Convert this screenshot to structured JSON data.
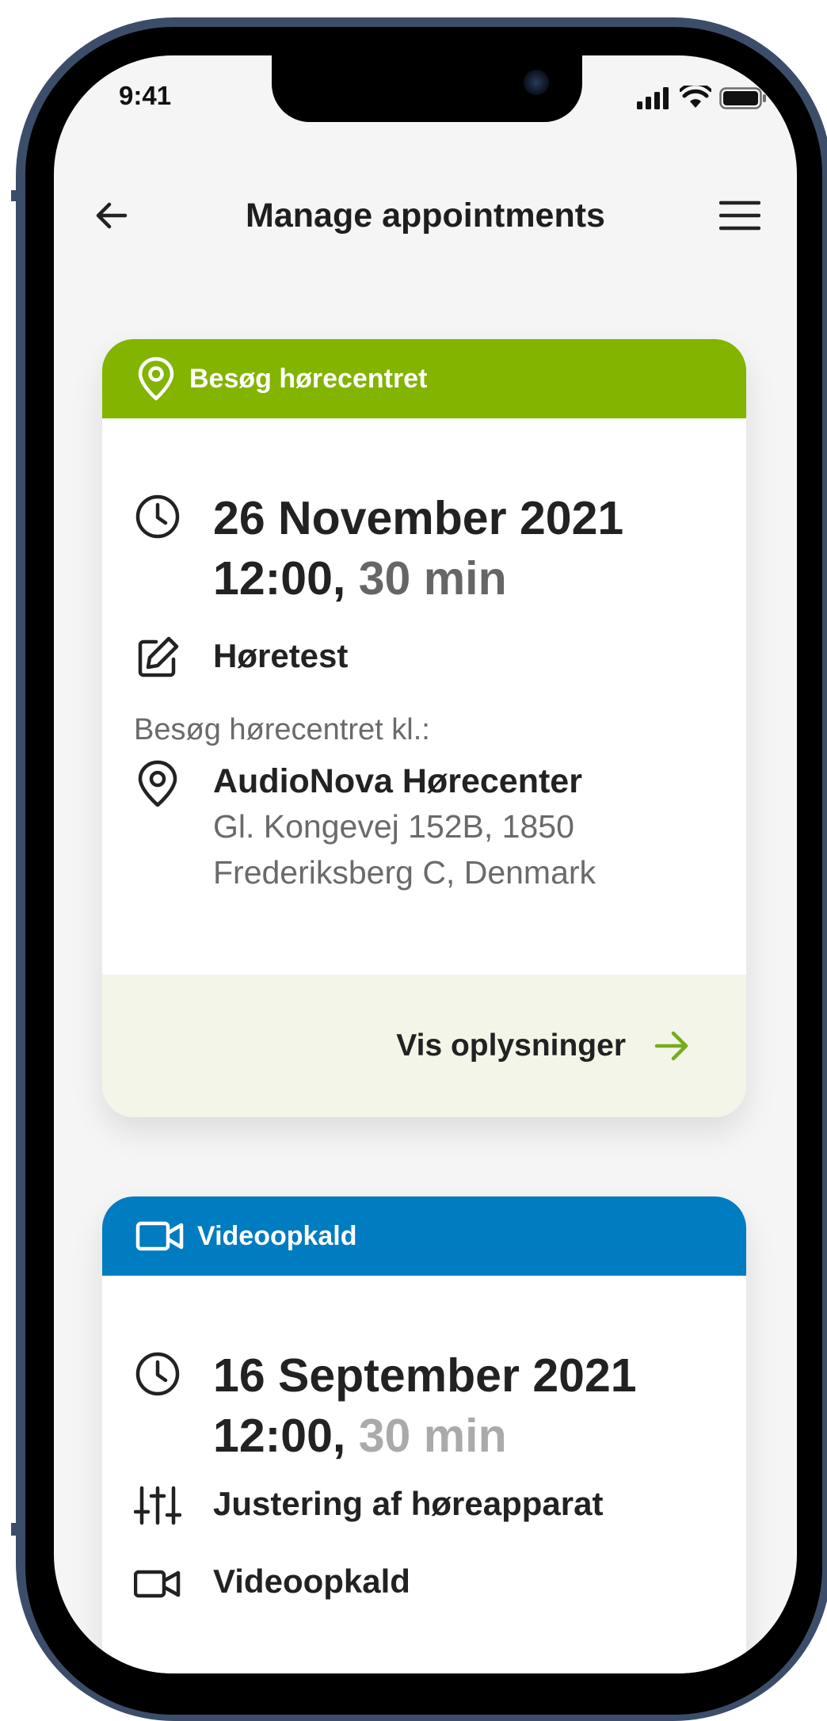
{
  "status_bar": {
    "time": "9:41"
  },
  "header": {
    "title": "Manage appointments"
  },
  "appointments": [
    {
      "category": "Besøg hørecentret",
      "category_color": "#82b400",
      "date": "26 November 2021",
      "time": "12:00,",
      "duration": "30 min",
      "type": "Høretest",
      "visit_label": "Besøg hørecentret kl.:",
      "location_name": "AudioNova Hørecenter",
      "address_line1": "Gl. Kongevej 152B, 1850",
      "address_line2": "Frederiksberg C, Denmark",
      "footer_link": "Vis oplysninger",
      "link_color": "#76ad1c"
    },
    {
      "category": "Videoopkald",
      "category_color": "#007cc0",
      "date": "16 September 2021",
      "time": "12:00,",
      "duration": "30 min",
      "type": "Justering af høreapparat",
      "meeting_mode": "Videoopkald"
    }
  ],
  "icons": {
    "back": "arrow-left-icon",
    "menu": "hamburger-menu-icon",
    "location": "map-pin-icon",
    "clock": "clock-icon",
    "edit": "edit-icon",
    "video": "video-camera-icon",
    "sliders": "sliders-icon",
    "arrow": "arrow-right-icon"
  }
}
